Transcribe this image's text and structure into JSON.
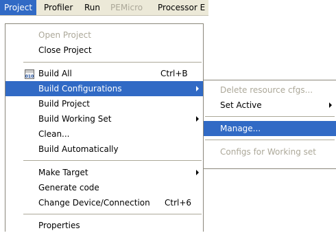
{
  "menubar": {
    "items": [
      {
        "label": "Project"
      },
      {
        "label": "Profiler"
      },
      {
        "label": "Run"
      },
      {
        "label": "PEMicro"
      },
      {
        "label": "Processor E"
      }
    ]
  },
  "menu": {
    "open_project": "Open Project",
    "close_project": "Close Project",
    "build_all": "Build All",
    "build_all_shortcut": "Ctrl+B",
    "build_all_icon_text": "010",
    "build_configurations": "Build Configurations",
    "build_project": "Build Project",
    "build_working_set": "Build Working Set",
    "clean": "Clean...",
    "build_automatically": "Build Automatically",
    "make_target": "Make Target",
    "generate_code": "Generate code",
    "change_device": "Change Device/Connection",
    "change_device_shortcut": "Ctrl+6",
    "properties": "Properties"
  },
  "submenu": {
    "delete_resource_cfgs": "Delete resource cfgs...",
    "set_active": "Set Active",
    "manage": "Manage...",
    "configs_for_working_set": "Configs for Working set"
  },
  "colors": {
    "highlight": "#316ac5",
    "menubar_bg": "#ece9d8",
    "disabled_text": "#aca899"
  }
}
